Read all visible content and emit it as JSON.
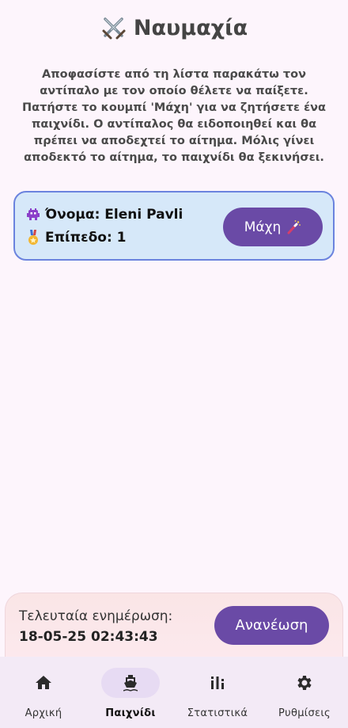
{
  "header": {
    "title": "Ναυμαχία",
    "title_icon": "crossed-swords-icon"
  },
  "intro_text": "Αποφασίστε από τη λίστα παρακάτω τον αντίπαλο με τον οποίο θέλετε να παίξετε. Πατήστε το κουμπί 'Μάχη' για να ζητήσετε ένα παιχνίδι. Ο αντίπαλος θα ειδοποιηθεί και θα πρέπει να αποδεχτεί το αίτημα. Μόλις γίνει αποδεκτό το αίτημα, το παιχνίδι θα ξεκινήσει.",
  "opponents": [
    {
      "name_line": "Όνομα: Eleni Pavli",
      "level_line": "Επίπεδο: 1",
      "name_icon": "alien-monster-icon",
      "level_icon": "medal-icon",
      "battle_label": "Μάχη",
      "battle_icon": "magic-wand-icon"
    }
  ],
  "update": {
    "label": "Τελευταία ενημέρωση:",
    "timestamp": "18-05-25 02:43:43",
    "refresh_label": "Ανανέωση"
  },
  "nav": {
    "items": [
      {
        "label": "Αρχική",
        "icon": "home-icon",
        "active": false
      },
      {
        "label": "Παιχνίδι",
        "icon": "ship-icon",
        "active": true
      },
      {
        "label": "Στατιστικά",
        "icon": "bar-chart-icon",
        "active": false
      },
      {
        "label": "Ρυθμίσεις",
        "icon": "gear-icon",
        "active": false
      }
    ]
  },
  "colors": {
    "background": "#fdf5fc",
    "accent": "#6a4aa6",
    "card_bg": "#d6e8f9",
    "card_border": "#6b83de"
  }
}
